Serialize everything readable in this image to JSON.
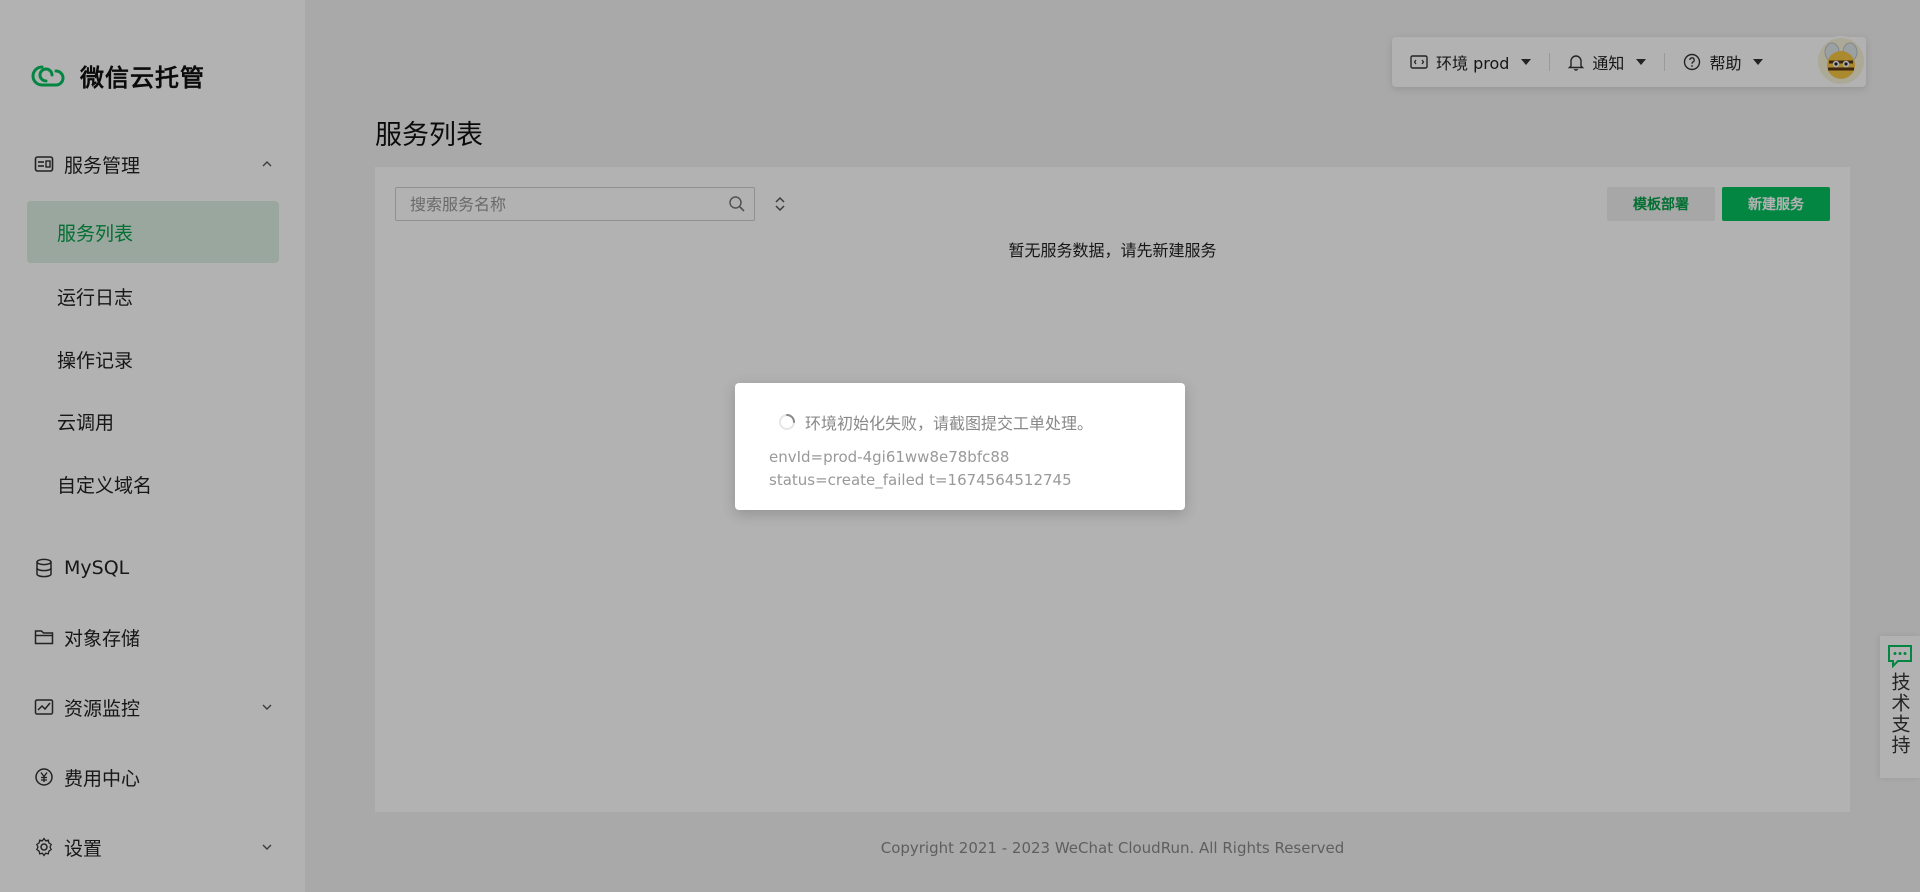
{
  "brand": {
    "name": "微信云托管",
    "logo_icon": "cloud-logo-icon",
    "color": "#07c160"
  },
  "sidebar": {
    "service_group": {
      "label": "服务管理",
      "expanded": true
    },
    "service_items": [
      {
        "label": "服务列表",
        "active": true
      },
      {
        "label": "运行日志",
        "active": false
      },
      {
        "label": "操作记录",
        "active": false
      },
      {
        "label": "云调用",
        "active": false
      },
      {
        "label": "自定义域名",
        "active": false
      }
    ],
    "groups": [
      {
        "label": "MySQL",
        "icon": "database-icon"
      },
      {
        "label": "对象存储",
        "icon": "folder-icon"
      },
      {
        "label": "资源监控",
        "icon": "monitor-chart-icon",
        "has_chevron": true
      },
      {
        "label": "费用中心",
        "icon": "yen-icon"
      },
      {
        "label": "设置",
        "icon": "gear-icon",
        "has_chevron": true
      }
    ]
  },
  "topbar": {
    "env_label": "环境 prod",
    "notify_label": "通知",
    "help_label": "帮助"
  },
  "page": {
    "title": "服务列表",
    "search_placeholder": "搜索服务名称",
    "template_button": "模板部署",
    "new_button": "新建服务",
    "empty_text": "暂无服务数据，请先新建服务"
  },
  "footer": {
    "copyright": "Copyright 2021 - 2023 WeChat CloudRun. All Rights Reserved"
  },
  "support": {
    "label": "技术支持"
  },
  "toast": {
    "message": "环境初始化失败，请截图提交工单处理。",
    "detail": "envId=prod-4gi61ww8e78bfc88 status=create_failed t=1674564512745"
  }
}
